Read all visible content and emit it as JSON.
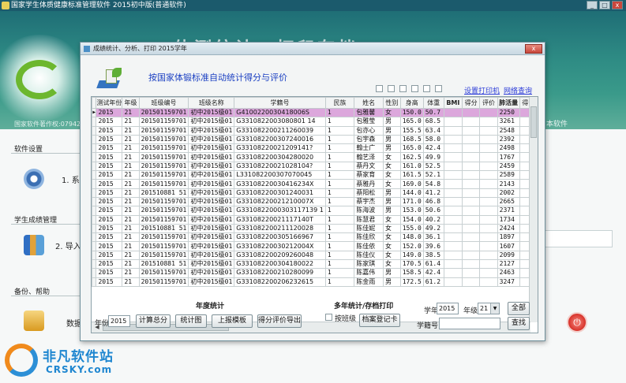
{
  "app": {
    "title": "国家学生体质健康标准管理软件 2015初中版(普通软件)",
    "window_buttons": [
      "_",
      "□",
      "x"
    ],
    "banner_text": "体测统计、打印存档",
    "banner_right_text": "欢迎使用本软件",
    "banner_left_text": "国家软件著作权:07942475",
    "sections": [
      {
        "header": "软件设置",
        "item": "1. 系",
        "icon": "gear-icon"
      },
      {
        "header": "学生成绩管理",
        "item": "2. 导入",
        "icon": "books-icon"
      },
      {
        "header": "备份、帮助",
        "item": "数据",
        "icon": "database-icon"
      }
    ],
    "exit_icon": "exit-icon"
  },
  "watermark": {
    "title": "非凡软件站",
    "sub": "CRSKY.com"
  },
  "dialog": {
    "title": "成绩统计、分析、打印  2015学年",
    "close_label": "x",
    "heading": "按国家体锻标准自动统计得分与评价",
    "links": {
      "print_settings": "设置打印机",
      "online_check": "网络查询"
    },
    "table": {
      "columns": [
        "测试年份",
        "年级",
        "班级编号",
        "班级名称",
        "学籍号",
        "民族",
        "姓名",
        "性别",
        "身高",
        "体重",
        "BMI",
        "得分",
        "评价",
        "肺活量",
        "得分"
      ],
      "rows": [
        [
          "2015",
          "21",
          "201501159701",
          "初中2015级01",
          "G4100220030418006S",
          "1",
          "包雅馨",
          "女",
          "150.0",
          "50.7",
          "",
          "",
          "",
          "2250",
          ""
        ],
        [
          "2015",
          "21",
          "201501159701",
          "初中2015级01",
          "G3310822003080801 14",
          "1",
          "包雅莹",
          "男",
          "165.0",
          "68.5",
          "",
          "",
          "",
          "3261",
          ""
        ],
        [
          "2015",
          "21",
          "201501159701",
          "初中2015级01",
          "G331082200211260039",
          "1",
          "包亦心",
          "男",
          "155.5",
          "63.4",
          "",
          "",
          "",
          "2548",
          ""
        ],
        [
          "2015",
          "21",
          "201501159701",
          "初中2015级01",
          "G331082200307240016",
          "1",
          "包宇森",
          "男",
          "168.5",
          "58.0",
          "",
          "",
          "",
          "2392",
          ""
        ],
        [
          "2015",
          "21",
          "201501159701",
          "初中2015级01",
          "G33108220021209141?",
          "1",
          "翰士广",
          "男",
          "165.0",
          "42.4",
          "",
          "",
          "",
          "2498",
          ""
        ],
        [
          "2015",
          "21",
          "201501159701",
          "初中2015级01",
          "G331082200304280020",
          "1",
          "翰艺泽",
          "女",
          "162.5",
          "49.9",
          "",
          "",
          "",
          "1767",
          ""
        ],
        [
          "2015",
          "21",
          "201501159701",
          "初中2015级01",
          "G33108220021028104?",
          "1",
          "蔡丹文",
          "女",
          "161.0",
          "52.5",
          "",
          "",
          "",
          "2459",
          ""
        ],
        [
          "2015",
          "21",
          "201501159701",
          "初中2015级01",
          "L331082200307070045",
          "1",
          "蔡家育",
          "女",
          "161.5",
          "52.1",
          "",
          "",
          "",
          "2589",
          ""
        ],
        [
          "2015",
          "21",
          "201501159701",
          "初中2015级01",
          "G33108220030416234X",
          "1",
          "蔡雅丹",
          "女",
          "169.0",
          "54.8",
          "",
          "",
          "",
          "2143",
          ""
        ],
        [
          "2015",
          "21",
          "201510881 51",
          "初中2015级01",
          "G331082200301240031",
          "1",
          "蔡阳松",
          "男",
          "144.0",
          "41.2",
          "",
          "",
          "",
          "2002",
          ""
        ],
        [
          "2015",
          "21",
          "201501159701",
          "初中2015级01",
          "G33108220021210007X",
          "1",
          "蔡宇杰",
          "男",
          "171.0",
          "46.8",
          "",
          "",
          "",
          "2665",
          ""
        ],
        [
          "2015",
          "21",
          "201501159701",
          "初中2015级01",
          "G3310822000303117139 1",
          "1",
          "陈海波",
          "男",
          "153.0",
          "50.6",
          "",
          "",
          "",
          "2371",
          ""
        ],
        [
          "2015",
          "21",
          "201501159701",
          "初中2015级01",
          "G33108220021117140T",
          "1",
          "陈慧君",
          "女",
          "154.0",
          "40.2",
          "",
          "",
          "",
          "1734",
          ""
        ],
        [
          "2015",
          "21",
          "201510881 51",
          "初中2015级01",
          "G331082200211120028",
          "1",
          "陈佳妮",
          "女",
          "155.0",
          "49.2",
          "",
          "",
          "",
          "2424",
          ""
        ],
        [
          "2015",
          "21",
          "201501159701",
          "初中2015级01",
          "G331082200305166967",
          "1",
          "陈佳欣",
          "女",
          "148.0",
          "36.1",
          "",
          "",
          "",
          "1897",
          ""
        ],
        [
          "2015",
          "21",
          "201501159701",
          "初中2015级01",
          "G33108220030212004X",
          "1",
          "陈佳依",
          "女",
          "152.0",
          "39.6",
          "",
          "",
          "",
          "1607",
          ""
        ],
        [
          "2015",
          "21",
          "201501159701",
          "初中2015级01",
          "G331082200209260048",
          "1",
          "陈佳仪",
          "女",
          "149.0",
          "38.5",
          "",
          "",
          "",
          "2099",
          ""
        ],
        [
          "2015",
          "21",
          "201510881 51",
          "初中2015级01",
          "G331082200304180022",
          "1",
          "陈家琪",
          "女",
          "170.5",
          "61.4",
          "",
          "",
          "",
          "2127",
          ""
        ],
        [
          "2015",
          "21",
          "201501159701",
          "初中2015级01",
          "G331082200210280099",
          "1",
          "陈嘉伟",
          "男",
          "158.5",
          "42.4",
          "",
          "",
          "",
          "2463",
          ""
        ],
        [
          "2015",
          "21",
          "201501159701",
          "初中2015级01",
          "G331082200206232615",
          "1",
          "陈金雨",
          "男",
          "172.5",
          "61.2",
          "",
          "",
          "",
          "3247",
          ""
        ]
      ]
    },
    "annual": {
      "header": "年度统计",
      "year_label": "年份",
      "year_value": "2015",
      "buttons": [
        "计算总分",
        "统计图",
        "上报模板",
        "得分评价导出"
      ]
    },
    "multi": {
      "header": "多年统计/存档打印",
      "by_class_label": "按班级",
      "archive_button": "档案登记卡"
    },
    "filter": {
      "school_year_label": "学年",
      "school_year_value": "2015",
      "grade_label": "年级",
      "grade_value": "21",
      "all_button": "全部",
      "student_id_label": "学籍号",
      "search_button": "查找"
    }
  }
}
